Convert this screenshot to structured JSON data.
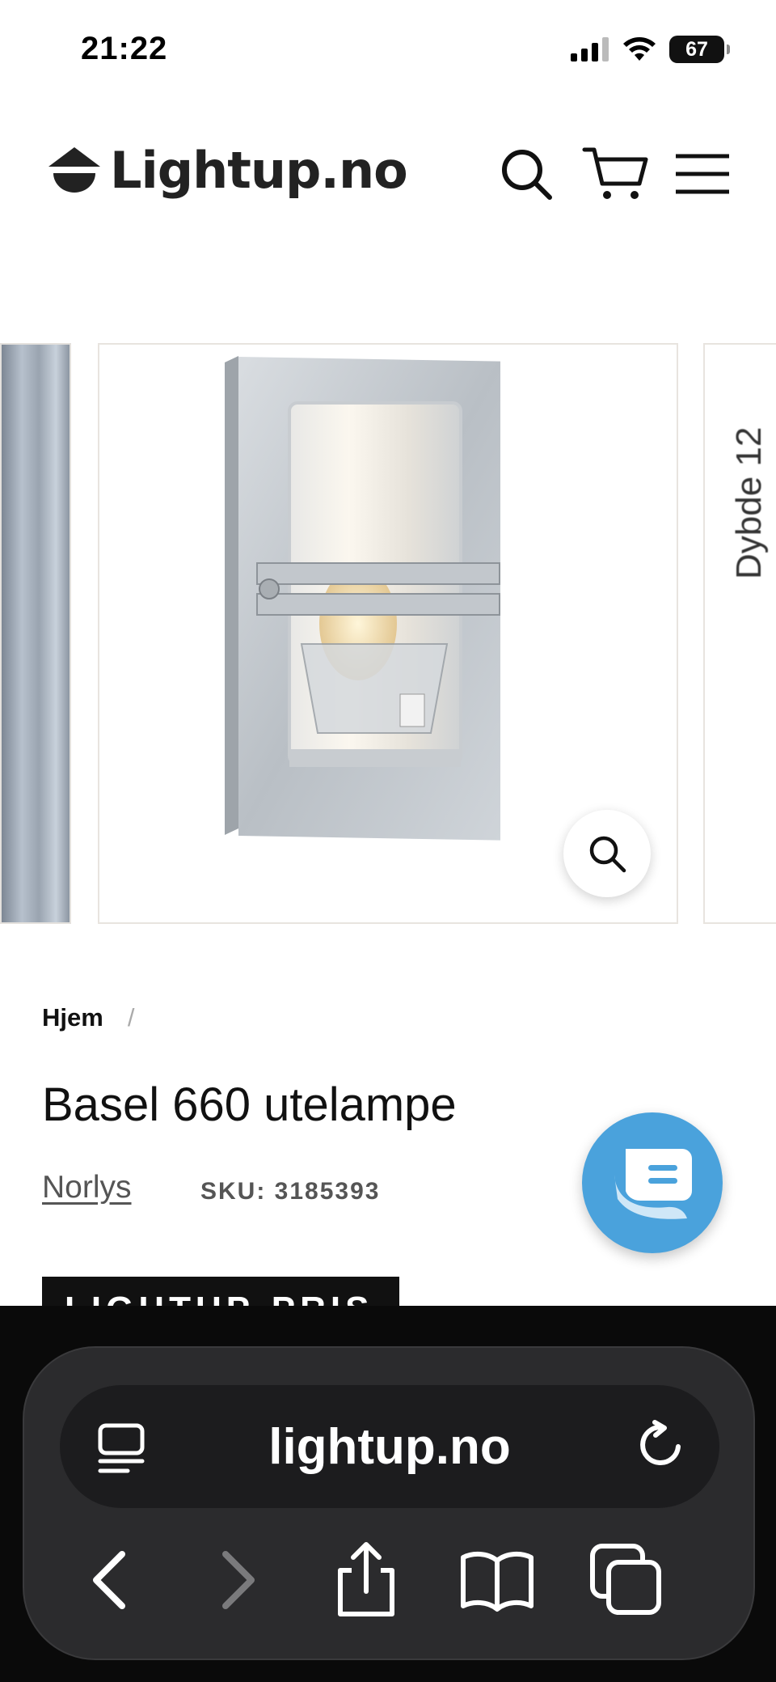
{
  "status_bar": {
    "time": "21:22",
    "battery": "67"
  },
  "header": {
    "logo_text": "Lightup.no",
    "icons": [
      "search-icon",
      "cart-icon",
      "menu-icon"
    ]
  },
  "gallery": {
    "next_slide_partial_text": "Dybde 12"
  },
  "product": {
    "breadcrumb_home": "Hjem",
    "breadcrumb_separator": "/",
    "title": "Basel 660 utelampe",
    "vendor": "Norlys",
    "sku": "SKU: 3185393",
    "price_badge": "LIGHTUP-PRIS"
  },
  "browser": {
    "url": "lightup.no"
  },
  "colors": {
    "chat_bubble": "#4aa2dc",
    "browser_bg": "#0a0a0a",
    "browser_panel": "#2b2b2d"
  }
}
